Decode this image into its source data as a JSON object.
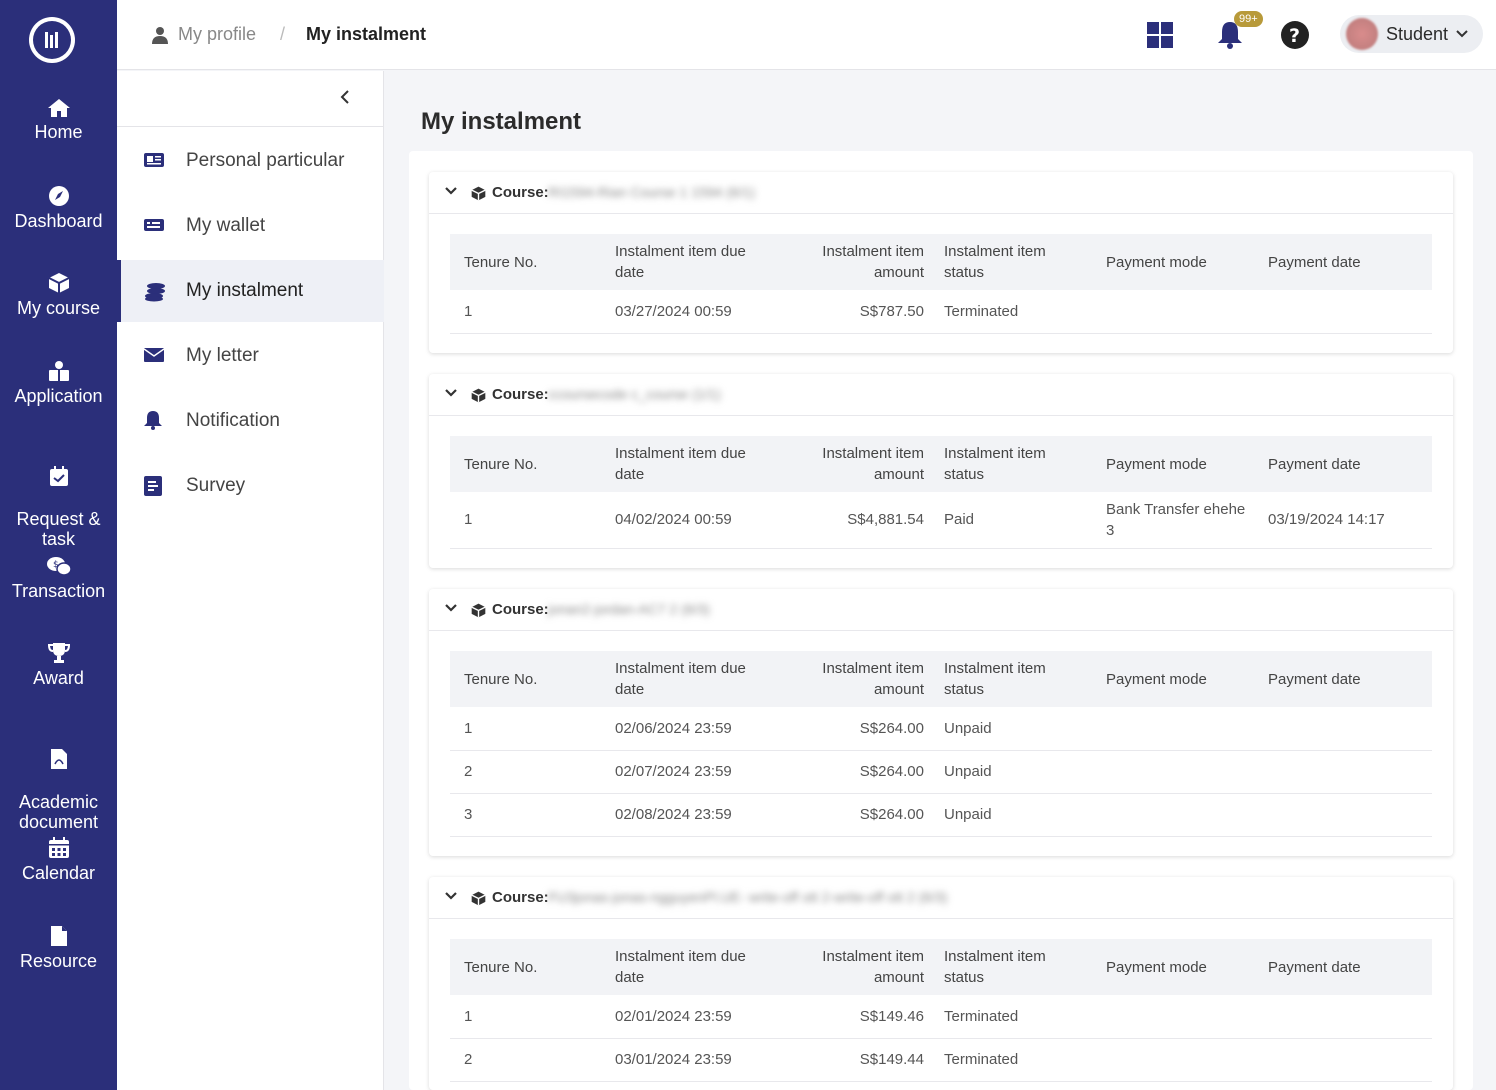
{
  "nav": {
    "items": [
      {
        "label": "Home",
        "icon": "home-icon"
      },
      {
        "label": "Dashboard",
        "icon": "dashboard-icon"
      },
      {
        "label": "My course",
        "icon": "course-icon"
      },
      {
        "label": "Application",
        "icon": "application-icon"
      },
      {
        "label": "Request &\ntask",
        "icon": "request-icon"
      },
      {
        "label": "Transaction",
        "icon": "transaction-icon"
      },
      {
        "label": "Award",
        "icon": "trophy-icon"
      },
      {
        "label": "Academic\ndocument",
        "icon": "document-icon"
      },
      {
        "label": "Calendar",
        "icon": "calendar-icon"
      },
      {
        "label": "Resource",
        "icon": "resource-icon"
      }
    ]
  },
  "header": {
    "breadcrumb_parent": "My profile",
    "breadcrumb_sep": "/",
    "breadcrumb_current": "My instalment",
    "badge": "99+",
    "user": "Student"
  },
  "submenu": {
    "items": [
      {
        "label": "Personal particular",
        "icon": "id-card-icon"
      },
      {
        "label": "My wallet",
        "icon": "wallet-icon"
      },
      {
        "label": "My instalment",
        "icon": "coins-icon"
      },
      {
        "label": "My letter",
        "icon": "envelope-icon"
      },
      {
        "label": "Notification",
        "icon": "bell-icon"
      },
      {
        "label": "Survey",
        "icon": "survey-icon"
      }
    ]
  },
  "main": {
    "title": "My instalment",
    "course_label": "Course:",
    "columns": [
      "Tenure No.",
      "Instalment item due date",
      "Instalment item amount",
      "Instalment item status",
      "Payment mode",
      "Payment date"
    ],
    "courses": [
      {
        "name": "RI1594-Rian Course 1 1594 (6/1)",
        "rows": [
          {
            "tenure": "1",
            "due": "03/27/2024 00:59",
            "amount": "S$787.50",
            "status": "Terminated",
            "mode": "",
            "date": ""
          }
        ]
      },
      {
        "name": "ccoursecode c_course (1/1)",
        "rows": [
          {
            "tenure": "1",
            "due": "04/02/2024 00:59",
            "amount": "S$4,881.54",
            "status": "Paid",
            "mode": "Bank Transfer ehehe 3",
            "date": "03/19/2024 14:17"
          }
        ]
      },
      {
        "name": "jonan2-jordan-AC7 2 (6/3)",
        "rows": [
          {
            "tenure": "1",
            "due": "02/06/2024 23:59",
            "amount": "S$264.00",
            "status": "Unpaid",
            "mode": "",
            "date": ""
          },
          {
            "tenure": "2",
            "due": "02/07/2024 23:59",
            "amount": "S$264.00",
            "status": "Unpaid",
            "mode": "",
            "date": ""
          },
          {
            "tenure": "3",
            "due": "02/08/2024 23:59",
            "amount": "S$264.00",
            "status": "Unpaid",
            "mode": "",
            "date": ""
          }
        ]
      },
      {
        "name": "FU3jonas-jonas-ngguyenPl.UE- write-off ott 2-write-off ott 2 (6/3)",
        "rows": [
          {
            "tenure": "1",
            "due": "02/01/2024 23:59",
            "amount": "S$149.46",
            "status": "Terminated",
            "mode": "",
            "date": ""
          },
          {
            "tenure": "2",
            "due": "03/01/2024 23:59",
            "amount": "S$149.44",
            "status": "Terminated",
            "mode": "",
            "date": ""
          }
        ]
      }
    ]
  }
}
